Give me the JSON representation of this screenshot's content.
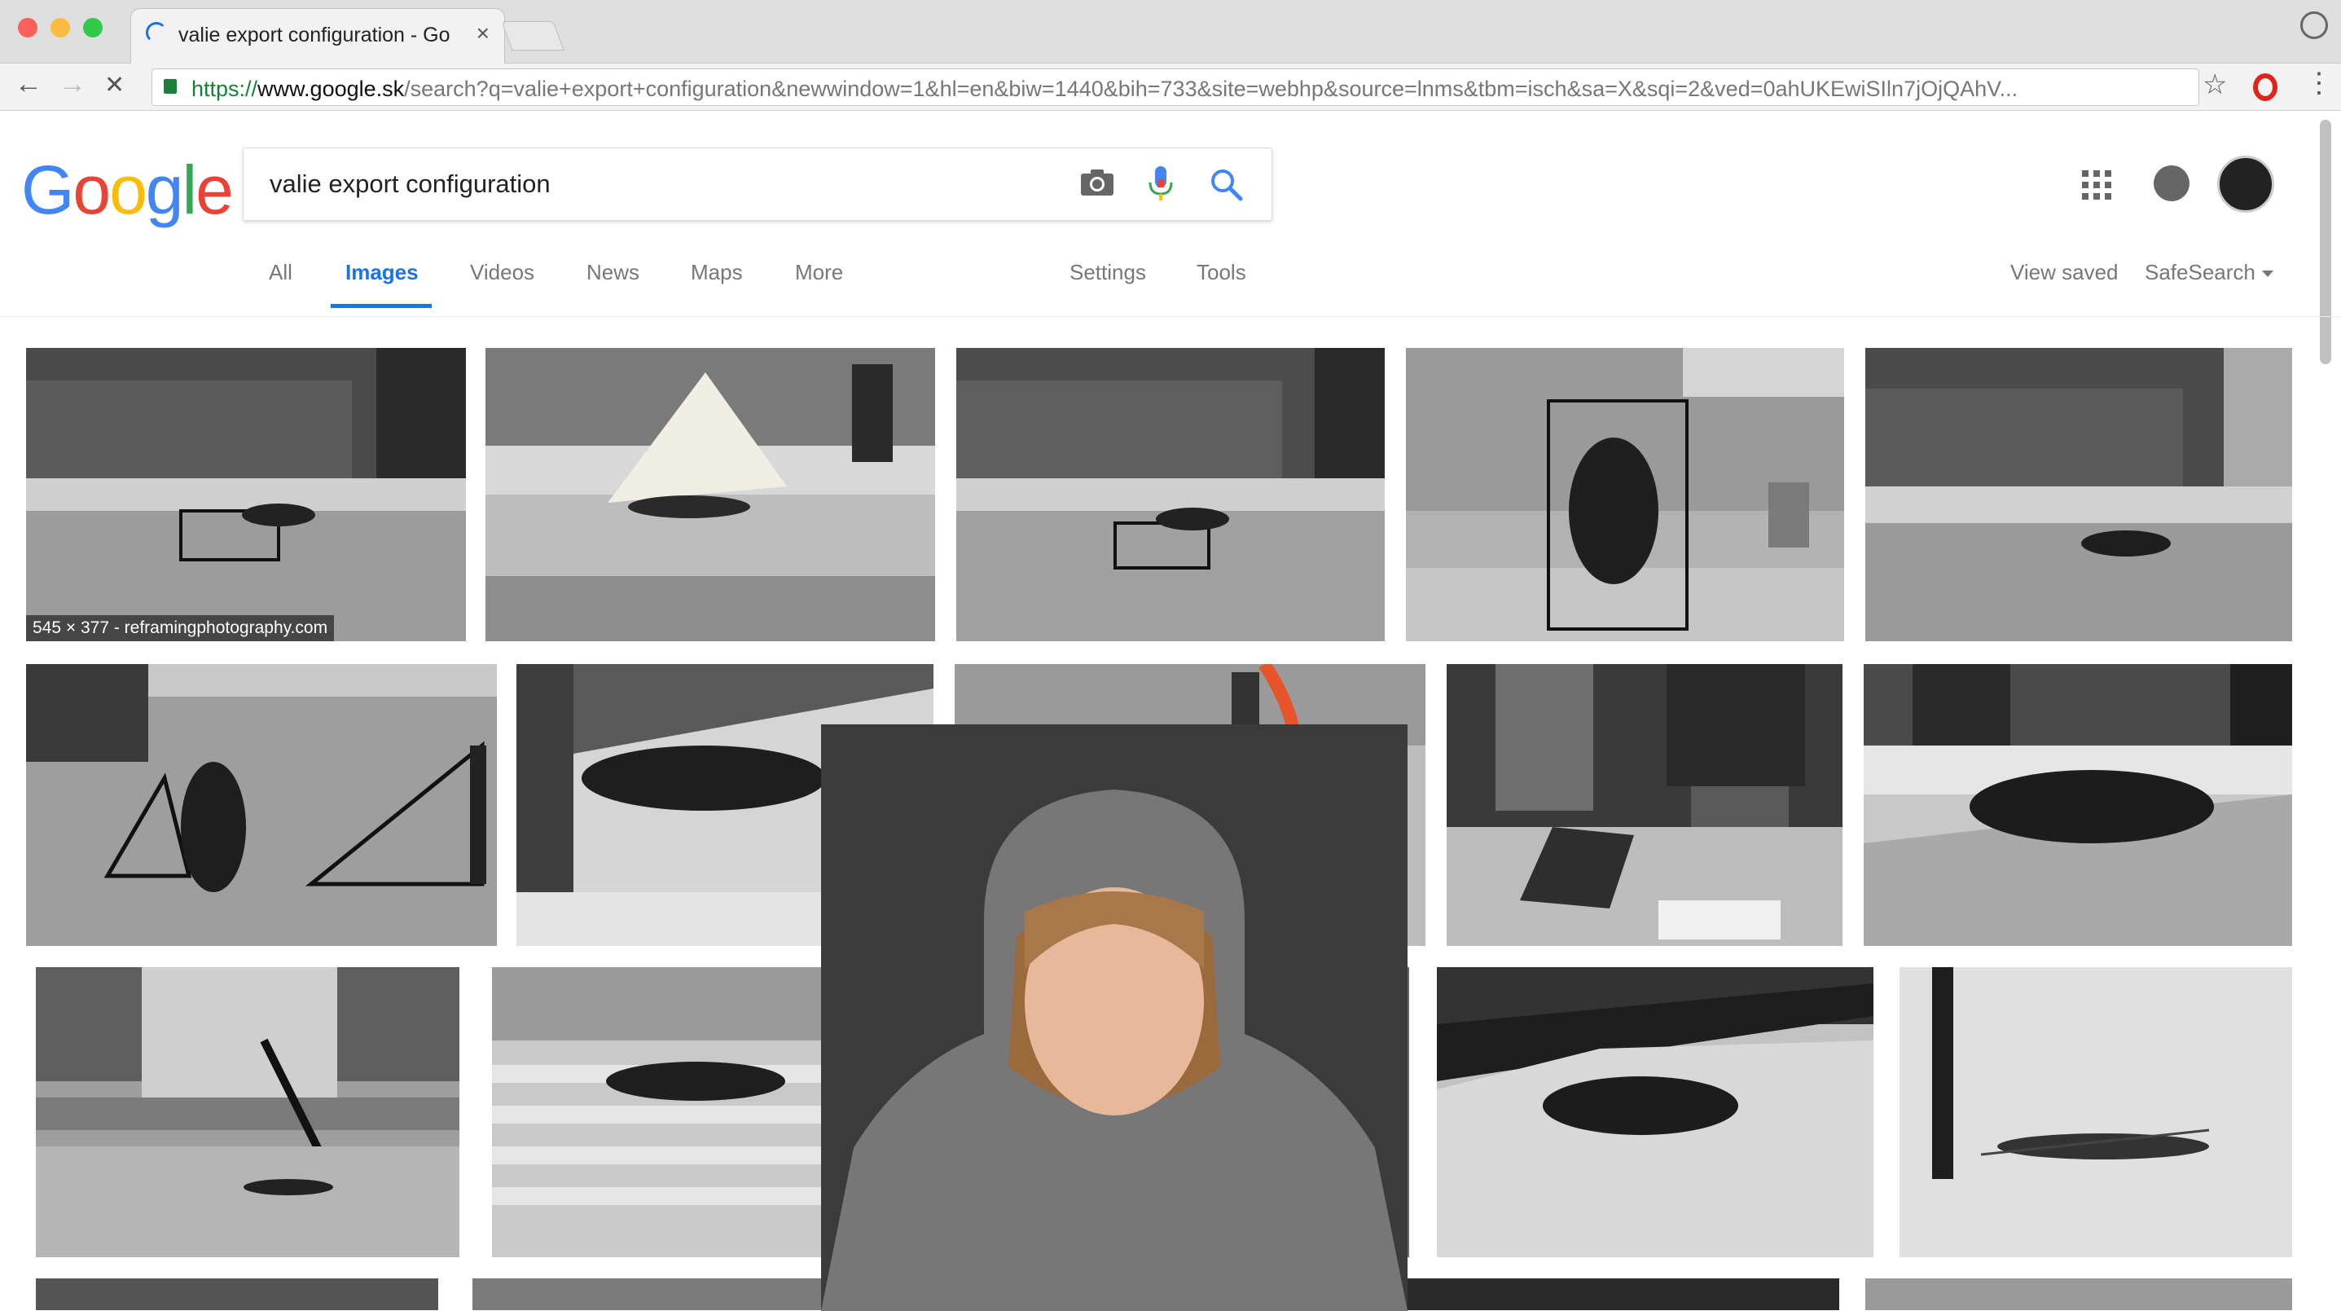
{
  "browser": {
    "tab_title": "valie export configuration - Go",
    "tab_close": "×",
    "url_scheme": "https://",
    "url_host": "www.google.sk",
    "url_path": "/search?q=valie+export+configuration&newwindow=1&hl=en&biw=1440&bih=733&site=webhp&source=lnms&tbm=isch&sa=X&sqi=2&ved=0ahUKEwiSIln7jOjQAhV...",
    "back": "←",
    "forward": "→",
    "stop": "✕",
    "star": "☆",
    "menu": "⋮"
  },
  "logo": {
    "letters": [
      "G",
      "o",
      "o",
      "g",
      "l",
      "e"
    ],
    "colors": [
      "#4285F4",
      "#EA4335",
      "#FBBC05",
      "#4285F4",
      "#34A853",
      "#EA4335"
    ]
  },
  "search": {
    "query": "valie export configuration"
  },
  "tabs": {
    "all": "All",
    "images": "Images",
    "videos": "Videos",
    "news": "News",
    "maps": "Maps",
    "more": "More",
    "settings": "Settings",
    "tools": "Tools",
    "view_saved": "View saved",
    "safesearch": "SafeSearch"
  },
  "results": {
    "first_caption": "545 × 377 - reframingphotography.com"
  },
  "colors": {
    "accent": "#1a73e8",
    "orange_stripe": "#e8542a"
  }
}
